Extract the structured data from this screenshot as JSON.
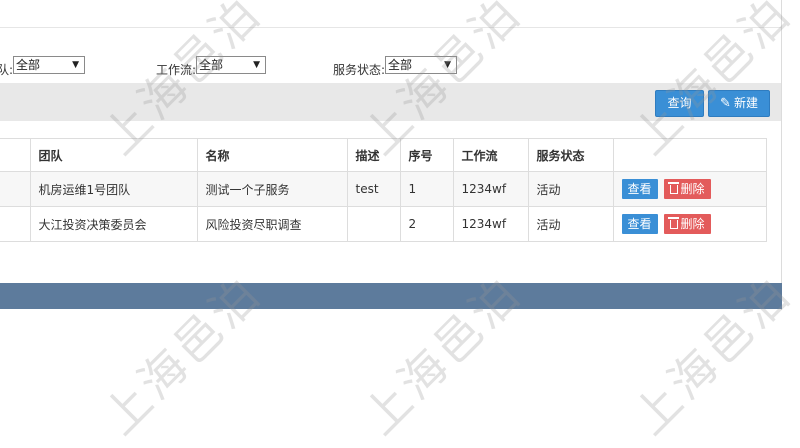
{
  "filters": [
    {
      "label": "队:",
      "value": "全部"
    },
    {
      "label": "工作流:",
      "value": "全部"
    },
    {
      "label": "服务状态:",
      "value": "全部"
    }
  ],
  "toolbar": {
    "query_label": "查询",
    "new_label": "新建"
  },
  "table": {
    "headers": [
      "团队",
      "名称",
      "描述",
      "序号",
      "工作流",
      "服务状态"
    ],
    "rows": [
      {
        "team": "机房运维1号团队",
        "name": "测试一个子服务",
        "desc": "test",
        "seq": "1",
        "workflow": "1234wf",
        "status": "活动"
      },
      {
        "team": "大江投资决策委员会",
        "name": "风险投资尽职调查",
        "desc": "",
        "seq": "2",
        "workflow": "1234wf",
        "status": "活动"
      }
    ],
    "view_label": "查看",
    "delete_label": "删除"
  },
  "watermark": "上海邑泊",
  "colors": {
    "primary": "#3a8fd6",
    "danger": "#e35b5b",
    "footer": "#5d7b9c"
  }
}
